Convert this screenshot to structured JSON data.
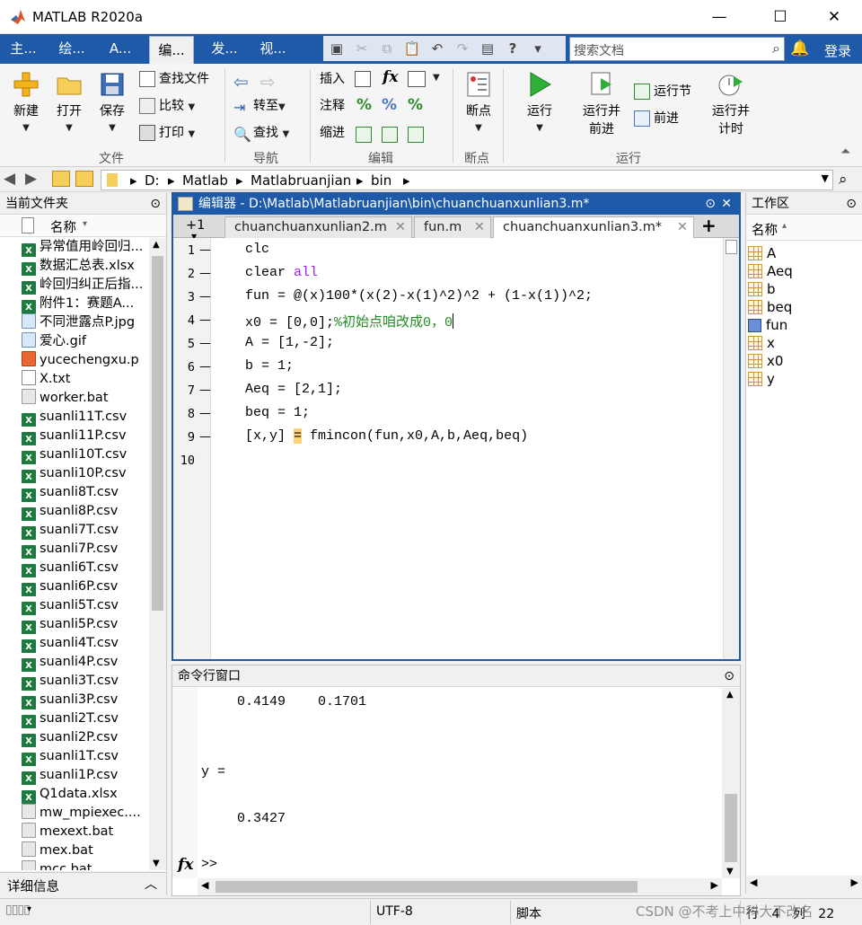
{
  "window": {
    "title": "MATLAB R2020a",
    "minimize": "—",
    "maximize": "☐",
    "close": "✕"
  },
  "ribbon_tabs": [
    "主...",
    "绘...",
    "A...",
    "编...",
    "发...",
    "视..."
  ],
  "search": {
    "placeholder": "搜索文档",
    "login": "登录"
  },
  "ribbon": {
    "file": {
      "new": "新建",
      "open": "打开",
      "save": "保存",
      "find_files": "查找文件",
      "compare": "比较",
      "print": "打印",
      "group": "文件"
    },
    "nav": {
      "goto": "转至",
      "find": "查找",
      "group": "导航"
    },
    "edit": {
      "insert": "插入",
      "comment": "注释",
      "indent": "缩进",
      "fx": "fx",
      "group": "编辑"
    },
    "breakpoints": {
      "label": "断点",
      "group": "断点"
    },
    "run": {
      "run": "运行",
      "run_advance_1": "运行并",
      "run_advance_2": "前进",
      "run_section": "运行节",
      "advance": "前进",
      "run_time_1": "运行并",
      "run_time_2": "计时",
      "group": "运行"
    }
  },
  "address": [
    "D:",
    "Matlab",
    "Matlabruanjian",
    "bin"
  ],
  "files_panel": {
    "title": "当前文件夹",
    "column": "名称",
    "details": "详细信息",
    "items": [
      {
        "name": "异常值用岭回归...",
        "type": "xls"
      },
      {
        "name": "数据汇总表.xlsx",
        "type": "xls"
      },
      {
        "name": "岭回归纠正后指...",
        "type": "xls"
      },
      {
        "name": "附件1：赛题A...",
        "type": "xls"
      },
      {
        "name": "不同泄露点P.jpg",
        "type": "img"
      },
      {
        "name": "爱心.gif",
        "type": "img"
      },
      {
        "name": "yucechengxu.p",
        "type": "matlab"
      },
      {
        "name": "X.txt",
        "type": "txt"
      },
      {
        "name": "worker.bat",
        "type": "bat"
      },
      {
        "name": "suanli11T.csv",
        "type": "xls"
      },
      {
        "name": "suanli11P.csv",
        "type": "xls"
      },
      {
        "name": "suanli10T.csv",
        "type": "xls"
      },
      {
        "name": "suanli10P.csv",
        "type": "xls"
      },
      {
        "name": "suanli8T.csv",
        "type": "xls"
      },
      {
        "name": "suanli8P.csv",
        "type": "xls"
      },
      {
        "name": "suanli7T.csv",
        "type": "xls"
      },
      {
        "name": "suanli7P.csv",
        "type": "xls"
      },
      {
        "name": "suanli6T.csv",
        "type": "xls"
      },
      {
        "name": "suanli6P.csv",
        "type": "xls"
      },
      {
        "name": "suanli5T.csv",
        "type": "xls"
      },
      {
        "name": "suanli5P.csv",
        "type": "xls"
      },
      {
        "name": "suanli4T.csv",
        "type": "xls"
      },
      {
        "name": "suanli4P.csv",
        "type": "xls"
      },
      {
        "name": "suanli3T.csv",
        "type": "xls"
      },
      {
        "name": "suanli3P.csv",
        "type": "xls"
      },
      {
        "name": "suanli2T.csv",
        "type": "xls"
      },
      {
        "name": "suanli2P.csv",
        "type": "xls"
      },
      {
        "name": "suanli1T.csv",
        "type": "xls"
      },
      {
        "name": "suanli1P.csv",
        "type": "xls"
      },
      {
        "name": "Q1data.xlsx",
        "type": "xls"
      },
      {
        "name": "mw_mpiexec....",
        "type": "bat"
      },
      {
        "name": "mexext.bat",
        "type": "bat"
      },
      {
        "name": "mex.bat",
        "type": "bat"
      },
      {
        "name": "mcc.bat",
        "type": "bat"
      }
    ]
  },
  "editor": {
    "title": "编辑器 - D:\\Matlab\\Matlabruanjian\\bin\\chuanchuanxunlian3.m*",
    "tabs": [
      "+1",
      "chuanchuanxunlian2.m",
      "fun.m",
      "chuanchuanxunlian3.m*"
    ],
    "lines": [
      {
        "n": "1",
        "code": "clc"
      },
      {
        "n": "2",
        "code": "clear ",
        "kw": "all"
      },
      {
        "n": "3",
        "code": "fun = @(x)100*(x(2)-x(1)^2)^2 + (1-x(1))^2;"
      },
      {
        "n": "4",
        "code": "x0 = [0,0];",
        "comment": "%初始点咱改成0，0"
      },
      {
        "n": "5",
        "code": "A = [1,-2];"
      },
      {
        "n": "6",
        "code": "b = 1;"
      },
      {
        "n": "7",
        "code": "Aeq = [2,1];"
      },
      {
        "n": "8",
        "code": "beq = 1;"
      },
      {
        "n": "9",
        "code_a": "[x,y] ",
        "warn": "=",
        "code_b": " fmincon(fun,x0,A,b,Aeq,beq)"
      },
      {
        "n": "10",
        "code": ""
      }
    ]
  },
  "command_window": {
    "title": "命令行窗口",
    "lines": [
      "    0.4149    0.1701",
      "y =",
      "    0.3427"
    ],
    "prompt": ">>"
  },
  "workspace": {
    "title": "工作区",
    "column": "名称",
    "items": [
      "A",
      "Aeq",
      "b",
      "beq",
      "fun",
      "x",
      "x0",
      "y"
    ]
  },
  "status": {
    "encoding": "UTF-8",
    "type": "脚本",
    "row_label": "行",
    "row": "4",
    "col_label": "列",
    "col": "22"
  },
  "watermark": "CSDN @不考上中科大不改名"
}
